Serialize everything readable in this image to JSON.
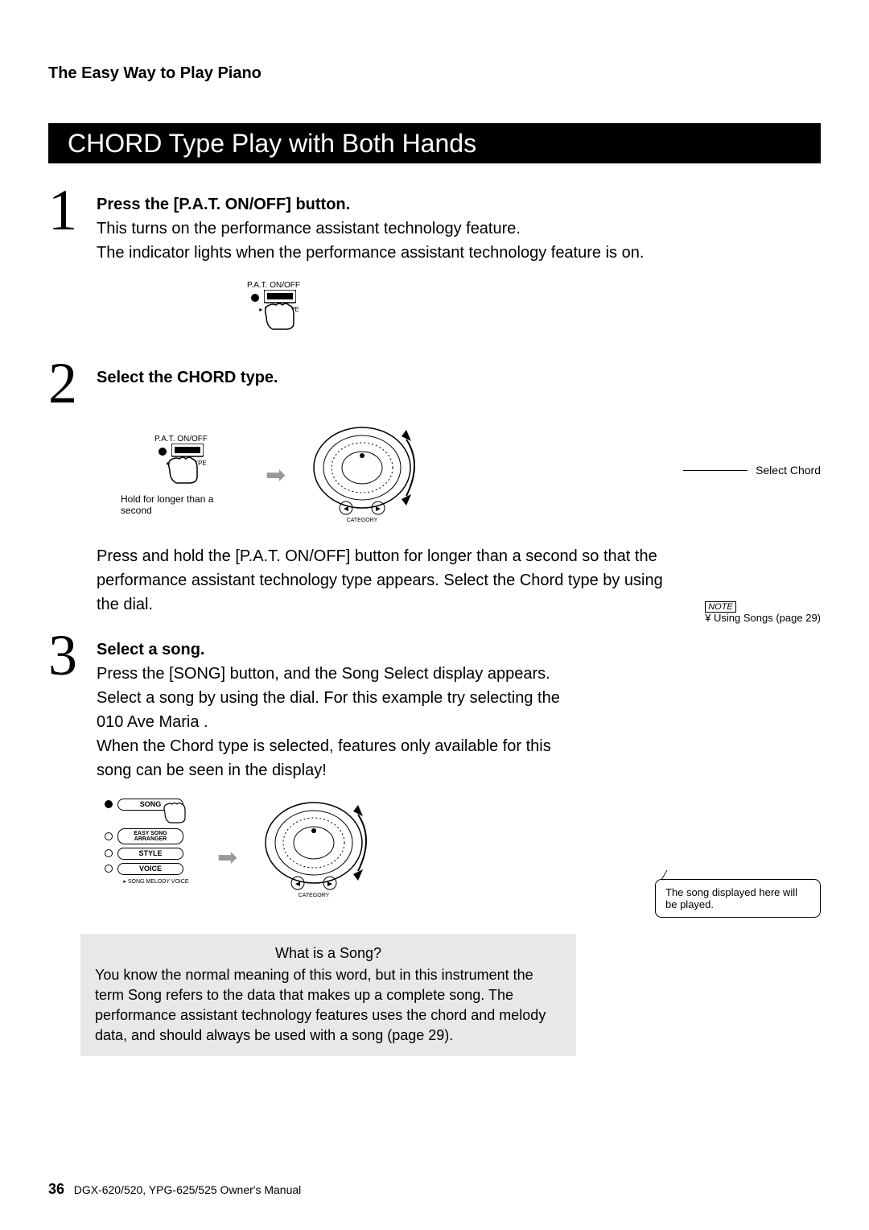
{
  "header": {
    "section": "The Easy Way to Play Piano"
  },
  "title_bar": "CHORD Type Play with Both Hands",
  "steps": [
    {
      "num": "1",
      "heading": "Press the [P.A.T. ON/OFF] button.",
      "body": "This turns on the performance assistant technology feature.\nThe indicator lights when the performance assistant technology feature is on.",
      "fig": {
        "btn_label": "P.A.T. ON/OFF",
        "btn_sub": "P.A.T. TYPE"
      }
    },
    {
      "num": "2",
      "heading": "Select the CHORD type.",
      "body2": "Press and hold the [P.A.T. ON/OFF] button for longer than a second so that the performance assistant technology type appears. Select the Chord type by using the dial.",
      "fig": {
        "btn_label": "P.A.T. ON/OFF",
        "btn_sub": "P.A.T. TYPE",
        "hold_caption": "Hold for longer than a second",
        "dial_label": "CATEGORY"
      },
      "callout": "Select Chord"
    },
    {
      "num": "3",
      "heading": "Select a song.",
      "body": "Press the [SONG] button, and the Song Select display appears. Select a song by using the dial. For this example try selecting the  010 Ave Maria .\nWhen the Chord type is selected, features only available for this song can be seen in the display!",
      "note_label": "NOTE",
      "note_text": "¥ Using Songs (page 29)",
      "fig": {
        "buttons": [
          {
            "label": "SONG",
            "on": true
          },
          {
            "label": "EASY SONG ARRANGER",
            "on": false
          },
          {
            "label": "STYLE",
            "on": false
          },
          {
            "label": "VOICE",
            "on": false
          }
        ],
        "sub": "SONG MELODY VOICE",
        "dial_label": "CATEGORY"
      },
      "display_text": "The song displayed here will be played."
    }
  ],
  "info_box": {
    "title": "What is a Song?",
    "body": "You know the normal meaning of this word, but in this instrument the term  Song  refers to the data that makes up a complete song. The performance assistant technology features uses the chord and melody data, and should always be used with a song (page 29)."
  },
  "footer": {
    "page": "36",
    "manual": "DGX-620/520, YPG-625/525  Owner's Manual"
  }
}
